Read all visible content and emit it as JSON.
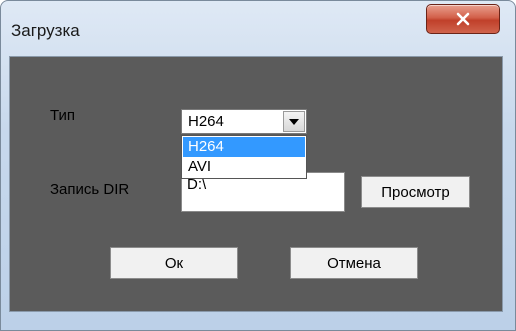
{
  "window": {
    "title": "Загрузка",
    "close_icon": "close-x-icon"
  },
  "form": {
    "type_label": "Тип",
    "type_select": {
      "value": "H264",
      "options": [
        "H264",
        "AVI"
      ],
      "highlighted": "H264"
    },
    "dir_label": "Запись DIR",
    "dir_value": "D:\\",
    "browse_label": "Просмотр",
    "ok_label": "Ок",
    "cancel_label": "Отмена"
  },
  "colors": {
    "client_background": "#5b5b5b",
    "selection": "#3399ff",
    "close_button": "#c7472f"
  }
}
